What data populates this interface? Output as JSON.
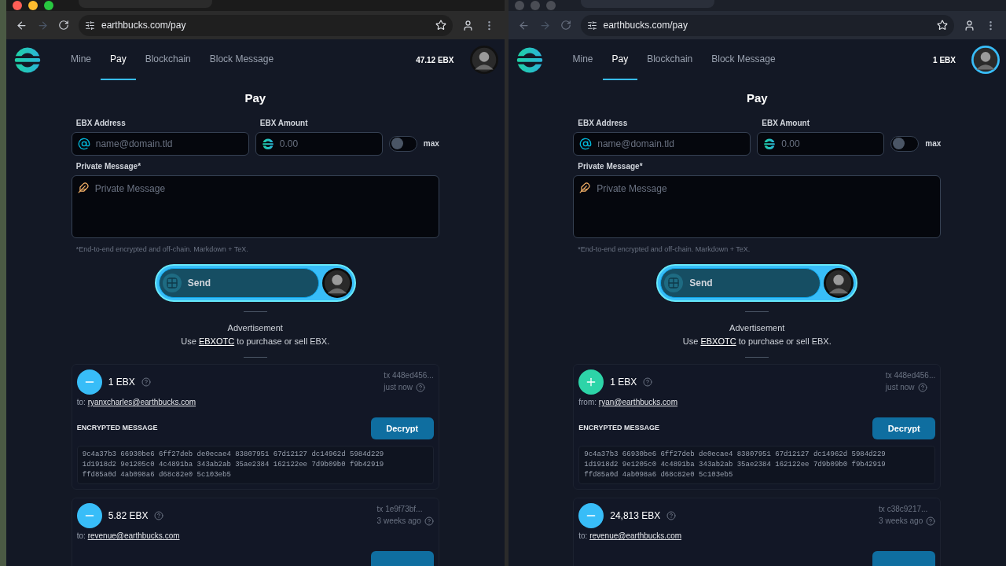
{
  "windows": [
    {
      "focused": true,
      "url": "earthbucks.com/pay",
      "nav": [
        {
          "label": "Mine",
          "selected": false
        },
        {
          "label": "Pay",
          "selected": true
        },
        {
          "label": "Blockchain",
          "selected": false
        },
        {
          "label": "Block Message",
          "selected": false
        }
      ],
      "balance": "47.12 EBX",
      "page_title": "Pay",
      "form": {
        "address_label": "EBX Address",
        "address_placeholder": "name@domain.tld",
        "amount_label": "EBX Amount",
        "amount_placeholder": "0.00",
        "max": {
          "label": "max",
          "on": false
        },
        "message_label": "Private Message*",
        "message_placeholder": "Private Message",
        "note": "*End-to-end encrypted and off-chain. Markdown + TeX.",
        "send": "Send"
      },
      "ad": {
        "heading": "Advertisement",
        "before": "Use",
        "link": "EBXOTC",
        "after": "to purchase or sell EBX."
      },
      "transactions": [
        {
          "kind": "out",
          "amount": "1 EBX",
          "party_prefix": "to:",
          "party": "ryanxcharles@earthbucks.com",
          "tx": "tx 448ed456...",
          "time": "just now",
          "message_heading": "ENCRYPTED MESSAGE",
          "decrypt": "Decrypt",
          "ciphertext": [
            "9c4a37b3 66930be6 6ff27deb de0ecae4 83807951 67d12127 dc14962d 5984d229",
            "1d1918d2 9e1205c0 4c4891ba 343ab2ab 35ae2384 162122ee 7d9b09b0 f9b42919",
            "ffd85a0d 4ab098a6 d68c82e0 5c103eb5"
          ]
        },
        {
          "kind": "out",
          "amount": "5.82 EBX",
          "party_prefix": "to:",
          "party": "revenue@earthbucks.com",
          "tx": "tx 1e9f73bf...",
          "time": "3 weeks ago"
        }
      ]
    },
    {
      "focused": false,
      "url": "earthbucks.com/pay",
      "nav": [
        {
          "label": "Mine",
          "selected": false
        },
        {
          "label": "Pay",
          "selected": true
        },
        {
          "label": "Blockchain",
          "selected": false
        },
        {
          "label": "Block Message",
          "selected": false
        }
      ],
      "balance": "1 EBX",
      "page_title": "Pay",
      "form": {
        "address_label": "EBX Address",
        "address_placeholder": "name@domain.tld",
        "amount_label": "EBX Amount",
        "amount_placeholder": "0.00",
        "max": {
          "label": "max",
          "on": false
        },
        "message_label": "Private Message*",
        "message_placeholder": "Private Message",
        "note": "*End-to-end encrypted and off-chain. Markdown + TeX.",
        "send": "Send"
      },
      "ad": {
        "heading": "Advertisement",
        "before": "Use",
        "link": "EBXOTC",
        "after": "to purchase or sell EBX."
      },
      "transactions": [
        {
          "kind": "in",
          "amount": "1 EBX",
          "party_prefix": "from:",
          "party": "ryan@earthbucks.com",
          "tx": "tx 448ed456...",
          "time": "just now",
          "message_heading": "ENCRYPTED MESSAGE",
          "decrypt": "Decrypt",
          "ciphertext": [
            "9c4a37b3 66930be6 6ff27deb de0ecae4 83807951 67d12127 dc14962d 5984d229",
            "1d1918d2 9e1205c0 4c4891ba 343ab2ab 35ae2384 162122ee 7d9b09b0 f9b42919",
            "ffd85a0d 4ab098a6 d68c82e0 5c103eb5"
          ]
        },
        {
          "kind": "out",
          "amount": "24,813 EBX",
          "party_prefix": "to:",
          "party": "revenue@earthbucks.com",
          "tx": "tx c38c9217...",
          "time": "3 weeks ago"
        }
      ]
    }
  ]
}
